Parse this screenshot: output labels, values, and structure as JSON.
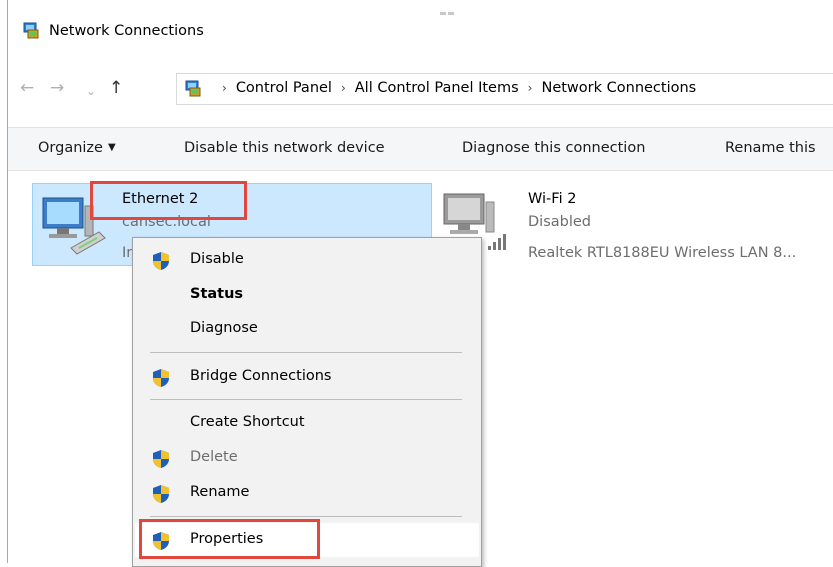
{
  "window": {
    "title": "Network Connections"
  },
  "nav": {
    "back_icon": "back-arrow-icon",
    "forward_icon": "forward-arrow-icon",
    "up_icon": "up-arrow-icon"
  },
  "address": {
    "crumbs": [
      "Control Panel",
      "All Control Panel Items",
      "Network Connections"
    ],
    "separator": "›"
  },
  "toolbar": {
    "organize": "Organize",
    "disable": "Disable this network device",
    "diagnose": "Diagnose this connection",
    "rename": "Rename this"
  },
  "connections": [
    {
      "name": "Ethernet 2",
      "line2": "cansec.local",
      "line3": "In",
      "selected": true,
      "icon": "ethernet-adapter-icon"
    },
    {
      "name": "Wi-Fi 2",
      "line2": "Disabled",
      "line3": "Realtek RTL8188EU Wireless LAN 8...",
      "selected": false,
      "icon": "wifi-adapter-icon"
    }
  ],
  "context_menu": {
    "items": [
      {
        "label": "Disable",
        "shield": true,
        "bold": false,
        "disabled": false
      },
      {
        "label": "Status",
        "shield": false,
        "bold": true,
        "disabled": false
      },
      {
        "label": "Diagnose",
        "shield": false,
        "bold": false,
        "disabled": false
      },
      {
        "label": "Bridge Connections",
        "shield": true,
        "bold": false,
        "disabled": false
      },
      {
        "label": "Create Shortcut",
        "shield": false,
        "bold": false,
        "disabled": false
      },
      {
        "label": "Delete",
        "shield": true,
        "bold": false,
        "disabled": true
      },
      {
        "label": "Rename",
        "shield": true,
        "bold": false,
        "disabled": false
      },
      {
        "label": "Properties",
        "shield": true,
        "bold": false,
        "disabled": false,
        "hovered": true
      }
    ]
  },
  "colors": {
    "selection_bg": "#cce8ff",
    "selection_border": "#99d1ff",
    "annotation_red": "#e0473d",
    "menu_bg": "#f2f2f2"
  }
}
